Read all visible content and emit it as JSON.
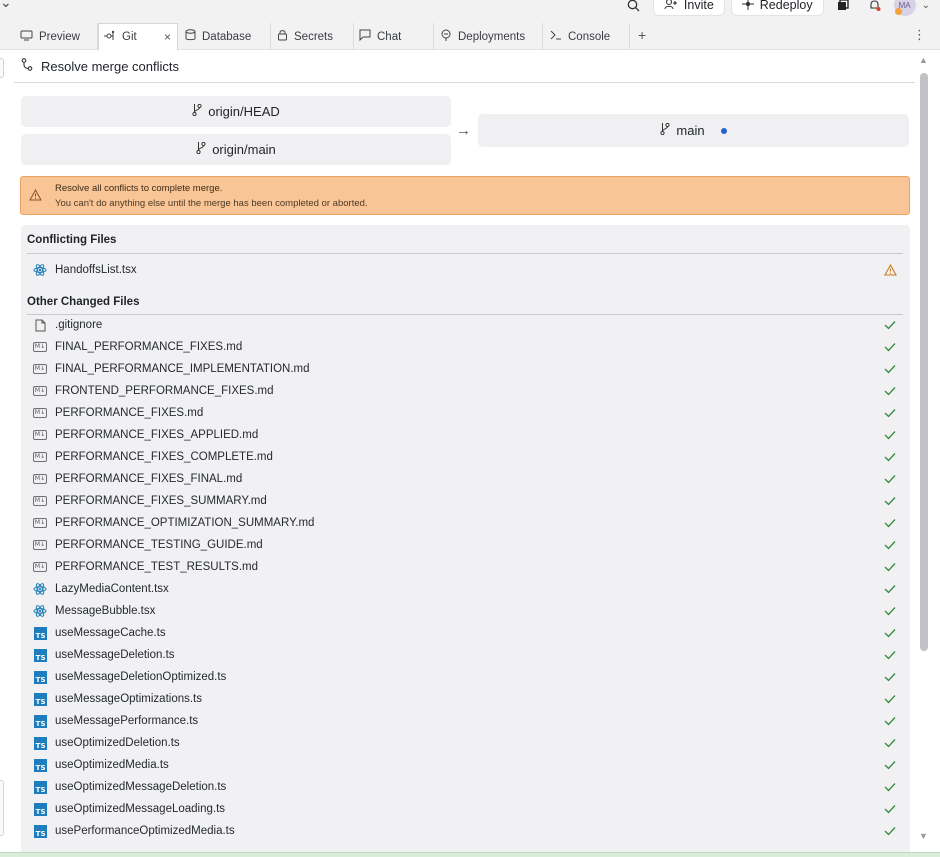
{
  "topbar": {
    "invite_label": "Invite",
    "redeploy_label": "Redeploy",
    "avatar_initials": "MA"
  },
  "tabs": [
    {
      "label": "Preview",
      "icon": "monitor-icon",
      "active": false
    },
    {
      "label": "Git",
      "icon": "git-icon",
      "active": true
    },
    {
      "label": "Database",
      "icon": "database-icon",
      "active": false
    },
    {
      "label": "Secrets",
      "icon": "lock-icon",
      "active": false
    },
    {
      "label": "Chat",
      "icon": "chat-icon",
      "active": false
    },
    {
      "label": "Deployments",
      "icon": "deploy-icon",
      "active": false
    },
    {
      "label": "Console",
      "icon": "terminal-icon",
      "active": false
    }
  ],
  "panel": {
    "title": "Resolve merge conflicts",
    "source_branches": [
      "origin/HEAD",
      "origin/main"
    ],
    "target_branch": "main"
  },
  "warning": {
    "title": "Resolve all conflicts to complete merge.",
    "body": "You can't do anything else until the merge has been completed or aborted."
  },
  "conflicting": {
    "title": "Conflicting Files",
    "files": [
      {
        "name": "HandoffsList.tsx",
        "type": "react",
        "status": "warning"
      }
    ]
  },
  "other": {
    "title": "Other Changed Files",
    "files": [
      {
        "name": ".gitignore",
        "type": "file",
        "status": "ok"
      },
      {
        "name": "FINAL_PERFORMANCE_FIXES.md",
        "type": "md",
        "status": "ok"
      },
      {
        "name": "FINAL_PERFORMANCE_IMPLEMENTATION.md",
        "type": "md",
        "status": "ok"
      },
      {
        "name": "FRONTEND_PERFORMANCE_FIXES.md",
        "type": "md",
        "status": "ok"
      },
      {
        "name": "PERFORMANCE_FIXES.md",
        "type": "md",
        "status": "ok"
      },
      {
        "name": "PERFORMANCE_FIXES_APPLIED.md",
        "type": "md",
        "status": "ok"
      },
      {
        "name": "PERFORMANCE_FIXES_COMPLETE.md",
        "type": "md",
        "status": "ok"
      },
      {
        "name": "PERFORMANCE_FIXES_FINAL.md",
        "type": "md",
        "status": "ok"
      },
      {
        "name": "PERFORMANCE_FIXES_SUMMARY.md",
        "type": "md",
        "status": "ok"
      },
      {
        "name": "PERFORMANCE_OPTIMIZATION_SUMMARY.md",
        "type": "md",
        "status": "ok"
      },
      {
        "name": "PERFORMANCE_TESTING_GUIDE.md",
        "type": "md",
        "status": "ok"
      },
      {
        "name": "PERFORMANCE_TEST_RESULTS.md",
        "type": "md",
        "status": "ok"
      },
      {
        "name": "LazyMediaContent.tsx",
        "type": "react",
        "status": "ok"
      },
      {
        "name": "MessageBubble.tsx",
        "type": "react",
        "status": "ok"
      },
      {
        "name": "useMessageCache.ts",
        "type": "ts",
        "status": "ok"
      },
      {
        "name": "useMessageDeletion.ts",
        "type": "ts",
        "status": "ok"
      },
      {
        "name": "useMessageDeletionOptimized.ts",
        "type": "ts",
        "status": "ok"
      },
      {
        "name": "useMessageOptimizations.ts",
        "type": "ts",
        "status": "ok"
      },
      {
        "name": "useMessagePerformance.ts",
        "type": "ts",
        "status": "ok"
      },
      {
        "name": "useOptimizedDeletion.ts",
        "type": "ts",
        "status": "ok"
      },
      {
        "name": "useOptimizedMedia.ts",
        "type": "ts",
        "status": "ok"
      },
      {
        "name": "useOptimizedMessageDeletion.ts",
        "type": "ts",
        "status": "ok"
      },
      {
        "name": "useOptimizedMessageLoading.ts",
        "type": "ts",
        "status": "ok"
      },
      {
        "name": "usePerformanceOptimizedMedia.ts",
        "type": "ts",
        "status": "ok"
      }
    ]
  },
  "colors": {
    "accent_blue": "#2563c9",
    "success_green": "#2f8a3a",
    "warning_bg": "#f9c596",
    "warning_border": "#e7a462",
    "warning_icon": "#c77a1e",
    "ts_blue": "#1e7dbf",
    "react_blue": "#1f7fb8"
  }
}
